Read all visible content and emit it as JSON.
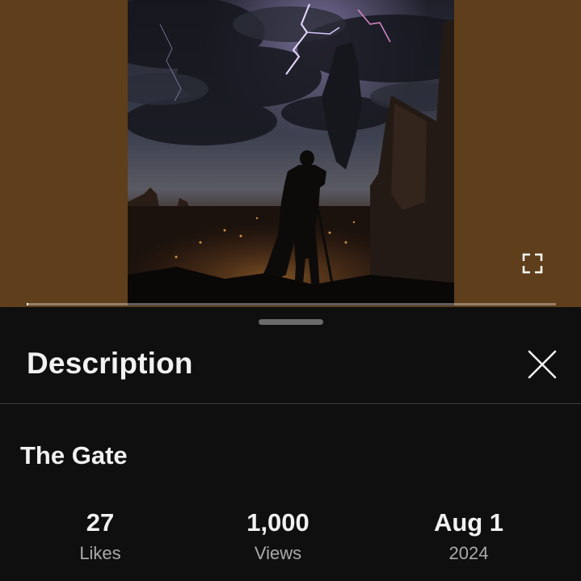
{
  "player": {
    "background_color": "#5e3e1b",
    "thumbnail_subject": "armored knight silhouette overlooking a glowing ruined city under a lightning storm",
    "fullscreen_icon": "fullscreen-icon",
    "progress_fraction": 0.003
  },
  "description_sheet": {
    "title": "Description",
    "close_icon": "close-icon"
  },
  "video": {
    "title": "The Gate",
    "stats": {
      "likes": {
        "value": "27",
        "label": "Likes"
      },
      "views": {
        "value": "1,000",
        "label": "Views"
      },
      "date": {
        "value": "Aug 1",
        "label": "2024"
      }
    }
  },
  "colors": {
    "sheet_background": "#0f0f0f",
    "primary_text": "#f1f1f1",
    "secondary_text": "#aaaaaa"
  }
}
